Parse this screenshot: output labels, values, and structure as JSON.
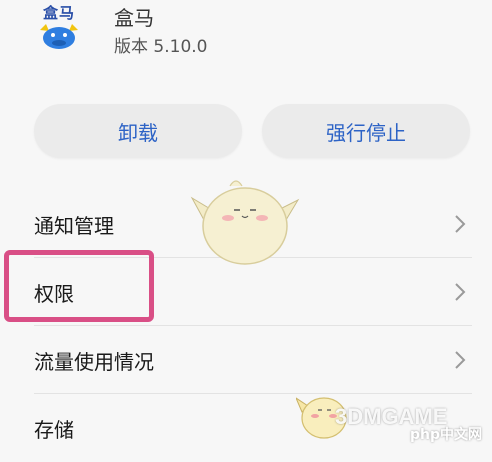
{
  "app": {
    "icon_text": "盒马",
    "name": "盒马",
    "version": "版本 5.10.0"
  },
  "buttons": {
    "uninstall": "卸载",
    "force_stop": "强行停止"
  },
  "settings": {
    "items": [
      {
        "label": "通知管理"
      },
      {
        "label": "权限"
      },
      {
        "label": "流量使用情况"
      },
      {
        "label": "存储"
      }
    ]
  },
  "watermark": {
    "text": "3DMGAME",
    "secondary": "php中文网"
  },
  "colors": {
    "accent": "#2d63c6",
    "highlight": "#d94f86",
    "button_bg": "#ebebeb"
  }
}
